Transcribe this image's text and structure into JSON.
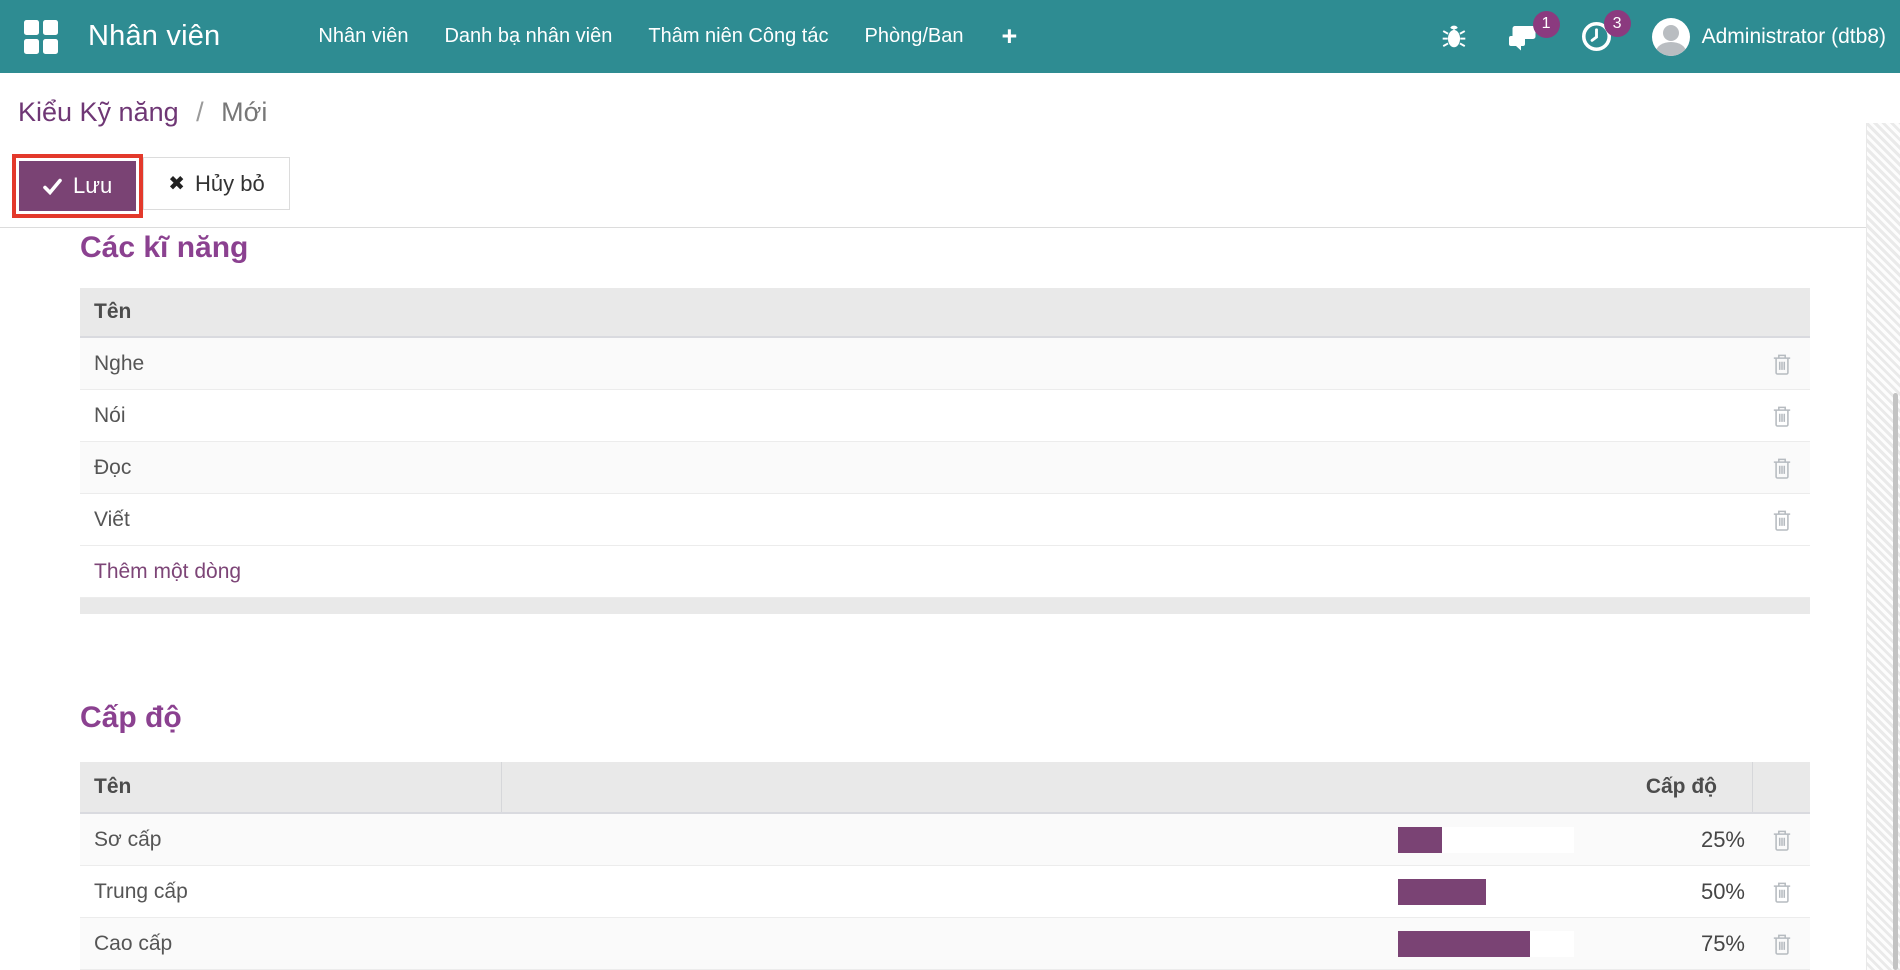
{
  "colors": {
    "navbar_bg": "#2E8C92",
    "primary": "#7A4374",
    "heading": "#8B4190",
    "link": "#7D4577",
    "badge": "#8B3A7F",
    "annotation_red": "#E3392B",
    "header_row_bg": "#E9E9E9",
    "row_alt_bg": "#FAFAFA",
    "text_dark": "#4C4C4C"
  },
  "navbar": {
    "app_name": "Nhân viên",
    "menu_items": [
      "Nhân viên",
      "Danh bạ nhân viên",
      "Thâm niên Công tác",
      "Phòng/Ban"
    ],
    "plus_label": "+",
    "badges": {
      "messages": "1",
      "activities": "3"
    },
    "user_name": "Administrator (dtb8)"
  },
  "breadcrumb": {
    "parent": "Kiểu Kỹ năng",
    "separator": "/",
    "current": "Mới"
  },
  "actions": {
    "save_label": "Lưu",
    "discard_label": "Hủy bỏ",
    "discard_icon": "✖"
  },
  "skills_section": {
    "title": "Các kĩ năng",
    "name_column": "Tên",
    "rows": [
      "Nghe",
      "Nói",
      "Đọc",
      "Viết"
    ],
    "add_line_label": "Thêm một dòng"
  },
  "levels_section": {
    "title": "Cấp độ",
    "name_column": "Tên",
    "level_column": "Cấp độ",
    "rows": [
      {
        "name": "Sơ cấp",
        "progress": 25,
        "percent_label": "25%"
      },
      {
        "name": "Trung cấp",
        "progress": 50,
        "percent_label": "50%"
      },
      {
        "name": "Cao cấp",
        "progress": 75,
        "percent_label": "75%"
      }
    ]
  },
  "chart_data": {
    "type": "bar",
    "title": "Cấp độ",
    "categories": [
      "Sơ cấp",
      "Trung cấp",
      "Cao cấp"
    ],
    "values": [
      25,
      50,
      75
    ],
    "ylim": [
      0,
      100
    ],
    "unit": "%"
  }
}
